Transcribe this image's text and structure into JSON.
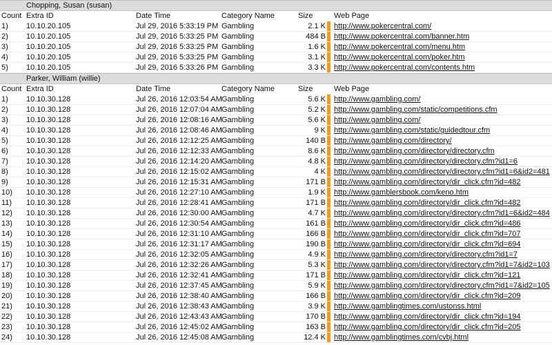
{
  "columns": {
    "count": "Count",
    "extra_id": "Extra ID",
    "date_time": "Date Time",
    "category": "Category Name",
    "size": "Size",
    "web_page": "Web Page"
  },
  "colors": {
    "bar": "#f39c12",
    "group_bg": "#dcdcdc"
  },
  "groups": [
    {
      "title": "Chopping, Susan (susan)",
      "rows": [
        {
          "count": "1)",
          "ip": "10.10.20.105",
          "dt": "Jul 29, 2016 5:33:19 PM",
          "cat": "Gambling",
          "size": "2.1 K",
          "url": "http://www.pokercentral.com/"
        },
        {
          "count": "2)",
          "ip": "10.10.20.105",
          "dt": "Jul 29, 2016 5:33:25 PM",
          "cat": "Gambling",
          "size": "484 B",
          "url": "http://www.pokercentral.com/banner.htm"
        },
        {
          "count": "3)",
          "ip": "10.10.20.105",
          "dt": "Jul 29, 2016 5:33:25 PM",
          "cat": "Gambling",
          "size": "1.6 K",
          "url": "http://www.pokercentral.com/menu.htm"
        },
        {
          "count": "4)",
          "ip": "10.10.20.105",
          "dt": "Jul 29, 2016 5:33:25 PM",
          "cat": "Gambling",
          "size": "3.1 K",
          "url": "http://www.pokercentral.com/poker.htm"
        },
        {
          "count": "5)",
          "ip": "10.10.20.105",
          "dt": "Jul 29, 2016 5:33:26 PM",
          "cat": "Gambling",
          "size": "3.3 K",
          "url": "http://www.pokercentral.com/contents.htm"
        }
      ]
    },
    {
      "title": "Parker, William (willie)",
      "rows": [
        {
          "count": "1)",
          "ip": "10.10.30.128",
          "dt": "Jul 26, 2016 12:03:54 AM",
          "cat": "Gambling",
          "size": "5.6 K",
          "url": "http://www.gambling.com/"
        },
        {
          "count": "2)",
          "ip": "10.10.30.128",
          "dt": "Jul 26, 2016 12:07:04 AM",
          "cat": "Gambling",
          "size": "5.2 K",
          "url": "http://www.gambling.com/static/competitions.cfm"
        },
        {
          "count": "3)",
          "ip": "10.10.30.128",
          "dt": "Jul 26, 2016 12:08:16 AM",
          "cat": "Gambling",
          "size": "5.6 K",
          "url": "http://www.gambling.com/"
        },
        {
          "count": "4)",
          "ip": "10.10.30.128",
          "dt": "Jul 26, 2016 12:08:46 AM",
          "cat": "Gambling",
          "size": "9 K",
          "url": "http://www.gambling.com/static/guidedtour.cfm"
        },
        {
          "count": "5)",
          "ip": "10.10.30.128",
          "dt": "Jul 26, 2016 12:12:25 AM",
          "cat": "Gambling",
          "size": "140 B",
          "url": "http://www.gambling.com/directory/"
        },
        {
          "count": "6)",
          "ip": "10.10.30.128",
          "dt": "Jul 26, 2016 12:12:33 AM",
          "cat": "Gambling",
          "size": "8.6 K",
          "url": "http://www.gambling.com/directory/directory.cfm"
        },
        {
          "count": "7)",
          "ip": "10.10.30.128",
          "dt": "Jul 26, 2016 12:14:20 AM",
          "cat": "Gambling",
          "size": "4.8 K",
          "url": "http://www.gambling.com/directory/directory.cfm?id1=6"
        },
        {
          "count": "8)",
          "ip": "10.10.30.128",
          "dt": "Jul 26, 2016 12:15:02 AM",
          "cat": "Gambling",
          "size": "4 K",
          "url": "http://www.gambling.com/directory/directory.cfm?id1=6&id2=481"
        },
        {
          "count": "9)",
          "ip": "10.10.30.128",
          "dt": "Jul 26, 2016 12:15:31 AM",
          "cat": "Gambling",
          "size": "171 B",
          "url": "http://www.gambling.com/directory/dir_click.cfm?id=482"
        },
        {
          "count": "10)",
          "ip": "10.10.30.128",
          "dt": "Jul 26, 2016 12:27:10 AM",
          "cat": "Gambling",
          "size": "1.9 K",
          "url": "http://www.gamblersbook.com/keno.htm"
        },
        {
          "count": "11)",
          "ip": "10.10.30.128",
          "dt": "Jul 26, 2016 12:28:41 AM",
          "cat": "Gambling",
          "size": "171 B",
          "url": "http://www.gambling.com/directory/dir_click.cfm?id=482"
        },
        {
          "count": "12)",
          "ip": "10.10.30.128",
          "dt": "Jul 26, 2016 12:30:00 AM",
          "cat": "Gambling",
          "size": "4.7 K",
          "url": "http://www.gambling.com/directory/directory.cfm?id1=6&id2=484"
        },
        {
          "count": "13)",
          "ip": "10.10.30.128",
          "dt": "Jul 26, 2016 12:30:54 AM",
          "cat": "Gambling",
          "size": "161 B",
          "url": "http://www.gambling.com/directory/dir_click.cfm?id=486"
        },
        {
          "count": "14)",
          "ip": "10.10.30.128",
          "dt": "Jul 26, 2016 12:31:10 AM",
          "cat": "Gambling",
          "size": "166 B",
          "url": "http://www.gambling.com/directory/dir_click.cfm?id=707"
        },
        {
          "count": "15)",
          "ip": "10.10.30.128",
          "dt": "Jul 26, 2016 12:31:17 AM",
          "cat": "Gambling",
          "size": "190 B",
          "url": "http://www.gambling.com/directory/dir_click.cfm?id=694"
        },
        {
          "count": "16)",
          "ip": "10.10.30.128",
          "dt": "Jul 26, 2016 12:32:05 AM",
          "cat": "Gambling",
          "size": "4.9 K",
          "url": "http://www.gambling.com/directory/directory.cfm?id1=7"
        },
        {
          "count": "17)",
          "ip": "10.10.30.128",
          "dt": "Jul 26, 2016 12:32:26 AM",
          "cat": "Gambling",
          "size": "5.3 K",
          "url": "http://www.gambling.com/directory/directory.cfm?id1=7&id2=103"
        },
        {
          "count": "18)",
          "ip": "10.10.30.128",
          "dt": "Jul 26, 2016 12:32:41 AM",
          "cat": "Gambling",
          "size": "171 B",
          "url": "http://www.gambling.com/directory/dir_click.cfm?id=121"
        },
        {
          "count": "19)",
          "ip": "10.10.30.128",
          "dt": "Jul 26, 2016 12:37:45 AM",
          "cat": "Gambling",
          "size": "5.9 K",
          "url": "http://www.gambling.com/directory/directory.cfm?id1=7&id2=105"
        },
        {
          "count": "20)",
          "ip": "10.10.30.128",
          "dt": "Jul 26, 2016 12:38:40 AM",
          "cat": "Gambling",
          "size": "166 B",
          "url": "http://www.gambling.com/directory/dir_click.cfm?id=209"
        },
        {
          "count": "21)",
          "ip": "10.10.30.128",
          "dt": "Jul 26, 2016 12:38:43 AM",
          "cat": "Gambling",
          "size": "3.9 K",
          "url": "http://www.gamblingtimes.com/ustonss.html"
        },
        {
          "count": "22)",
          "ip": "10.10.30.128",
          "dt": "Jul 26, 2016 12:43:43 AM",
          "cat": "Gambling",
          "size": "170 B",
          "url": "http://www.gambling.com/directory/dir_click.cfm?id=194"
        },
        {
          "count": "23)",
          "ip": "10.10.30.128",
          "dt": "Jul 26, 2016 12:45:02 AM",
          "cat": "Gambling",
          "size": "163 B",
          "url": "http://www.gambling.com/directory/dir_click.cfm?id=205"
        },
        {
          "count": "24)",
          "ip": "10.10.30.128",
          "dt": "Jul 26, 2016 12:45:08 AM",
          "cat": "Gambling",
          "size": "12.4 K",
          "url": "http://www.gamblingtimes.com/cvbj.html"
        }
      ]
    }
  ]
}
